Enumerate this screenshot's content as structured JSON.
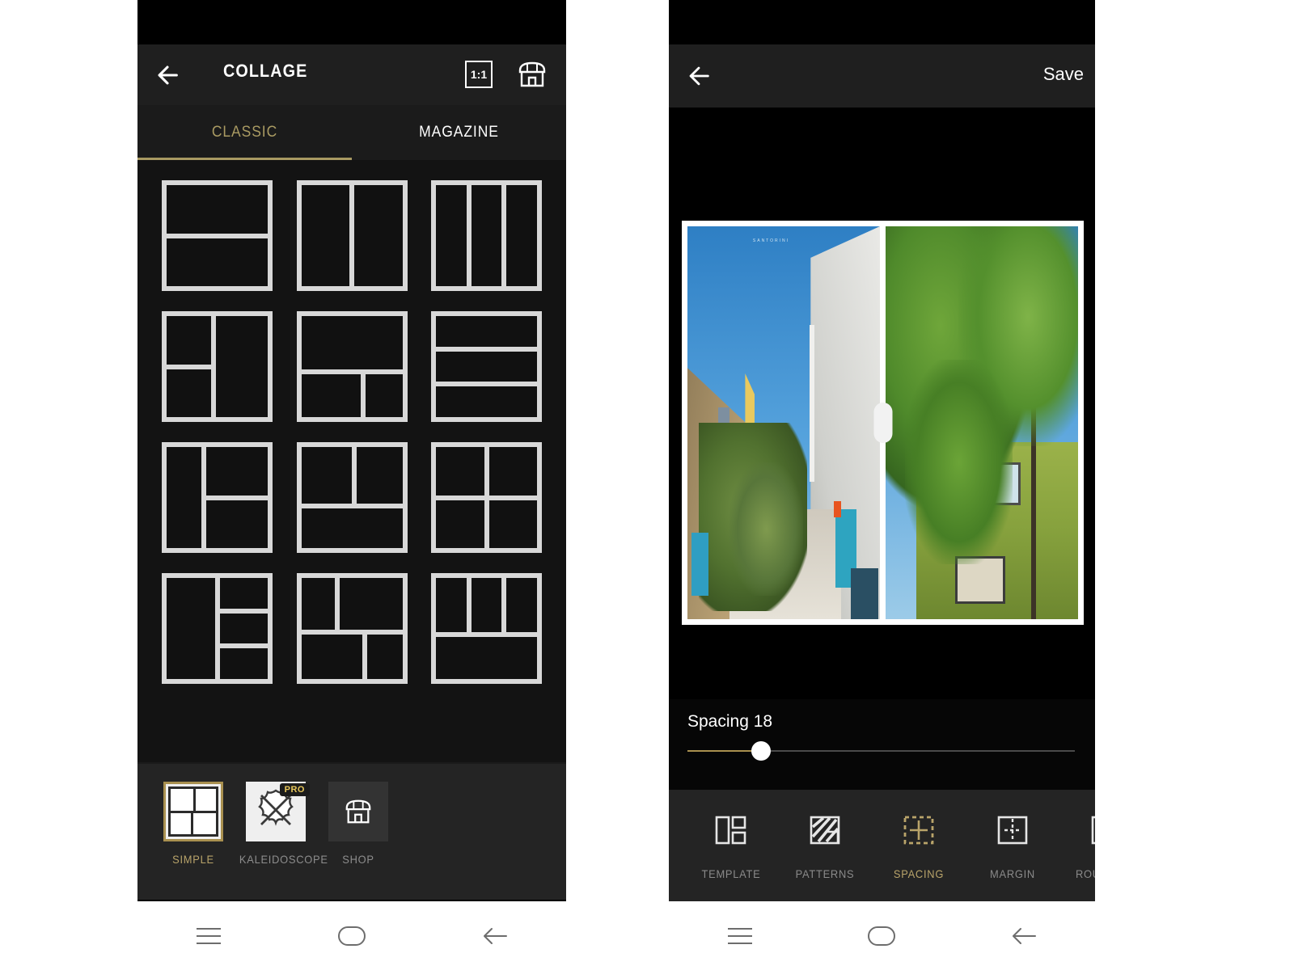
{
  "left_screen": {
    "header": {
      "back_icon": "back-arrow-icon",
      "title": "COLLAGE",
      "ratio_label": "1:1",
      "shop_icon": "shop-icon"
    },
    "tabs": [
      {
        "label": "CLASSIC",
        "active": true
      },
      {
        "label": "MAGAZINE",
        "active": false
      }
    ],
    "templates": [
      {
        "name": "two-rows",
        "layout": [
          [
            1
          ],
          [
            1
          ]
        ]
      },
      {
        "name": "two-columns",
        "layout": [
          [
            1,
            1
          ]
        ]
      },
      {
        "name": "three-columns",
        "layout": [
          [
            1,
            1,
            1
          ]
        ]
      },
      {
        "name": "left-split-right-tall",
        "layout": [
          [
            1,
            1
          ],
          [
            1,
            0
          ]
        ]
      },
      {
        "name": "top-wide-bottom-two",
        "layout": [
          [
            1
          ],
          [
            1,
            1
          ]
        ]
      },
      {
        "name": "three-rows",
        "layout": [
          [
            1
          ],
          [
            1
          ],
          [
            1
          ]
        ]
      },
      {
        "name": "left-tall-right-split",
        "layout": [
          [
            0,
            1
          ],
          [
            1,
            1
          ]
        ]
      },
      {
        "name": "two-top-one-bottom",
        "layout": [
          [
            1,
            1
          ],
          [
            1
          ]
        ]
      },
      {
        "name": "four-quadrants",
        "layout": [
          [
            1,
            1
          ],
          [
            1,
            1
          ]
        ]
      },
      {
        "name": "left-tall-right-stack",
        "layout": [
          [
            0,
            1
          ],
          [
            0,
            1
          ],
          [
            0,
            1
          ]
        ]
      },
      {
        "name": "mixed-five",
        "layout": [
          [
            1,
            1
          ],
          [
            1,
            1
          ]
        ]
      },
      {
        "name": "three-top-one-bottom",
        "layout": [
          [
            1,
            1,
            1
          ],
          [
            1
          ]
        ]
      }
    ],
    "bottom_tools": [
      {
        "label": "SIMPLE",
        "icon": "grid-thumbnail-icon",
        "selected": true,
        "pro": false
      },
      {
        "label": "KALEIDOSCOPE",
        "icon": "kaleidoscope-icon",
        "selected": false,
        "pro": true,
        "pro_label": "PRO"
      },
      {
        "label": "SHOP",
        "icon": "shop-icon",
        "selected": false,
        "pro": false
      }
    ]
  },
  "right_screen": {
    "header": {
      "back_icon": "back-arrow-icon",
      "save_label": "Save"
    },
    "collage": {
      "photos": [
        {
          "name": "alley-photo",
          "caption": ""
        },
        {
          "name": "trailer-tree-photo",
          "caption": ""
        }
      ],
      "divider_handle": "drag-handle"
    },
    "spacing": {
      "label": "Spacing 18",
      "value": 18,
      "min": 0,
      "max": 100,
      "percent": 19
    },
    "bottom_tools": [
      {
        "label": "TEMPLATE",
        "icon": "template-icon",
        "active": false
      },
      {
        "label": "PATTERNS",
        "icon": "patterns-icon",
        "active": false
      },
      {
        "label": "SPACING",
        "icon": "spacing-icon",
        "active": true
      },
      {
        "label": "MARGIN",
        "icon": "margin-icon",
        "active": false
      },
      {
        "label": "ROUNDING",
        "icon": "rounding-icon",
        "active": false
      }
    ]
  },
  "navbar": {
    "buttons": [
      {
        "name": "recents-button",
        "icon": "hamburger-icon"
      },
      {
        "name": "home-button",
        "icon": "circle-icon"
      },
      {
        "name": "back-button",
        "icon": "back-arrow-icon"
      }
    ]
  },
  "colors": {
    "accent_gold": "#a99a62",
    "selected_gold": "#b9a46a",
    "panel_bg": "#1b1b1b",
    "toolbar_bg": "#242424"
  }
}
